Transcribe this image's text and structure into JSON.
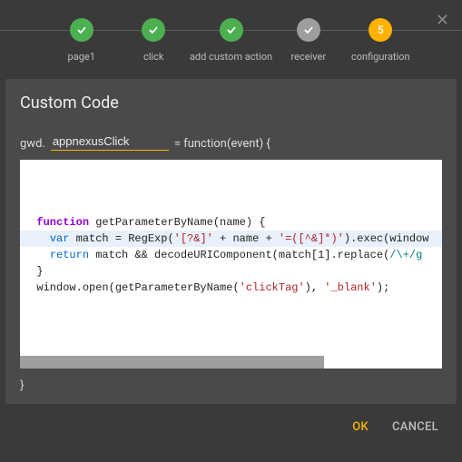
{
  "stepper": {
    "steps": [
      {
        "label": "page1",
        "state": "done"
      },
      {
        "label": "click",
        "state": "done"
      },
      {
        "label": "add custom action",
        "state": "done"
      },
      {
        "label": "receiver",
        "state": "grey"
      },
      {
        "label": "configuration",
        "state": "active",
        "number": "5"
      }
    ]
  },
  "colors": {
    "done": "#4caf50",
    "grey": "#9e9e9e",
    "active": "#ffb300"
  },
  "panel": {
    "title": "Custom Code",
    "prefix": "gwd.",
    "function_name": "appnexusClick",
    "suffix": "= function(event) {",
    "closing": "}"
  },
  "code": {
    "line1_kw": "function",
    "line1_name": " getParameterByName(name) {",
    "line2_kw": "var",
    "line2_a": " match = RegExp(",
    "line2_s1": "'[?&]'",
    "line2_b": " + name + ",
    "line2_s2": "'=([^&]*)'",
    "line2_c": ").exec(window",
    "line3_kw": "return",
    "line3_a": " match && decodeURIComponent(match[1].replace(",
    "line3_re": "/\\+/g",
    "line4": "}",
    "line5_a": "window.open(getParameterByName(",
    "line5_s1": "'clickTag'",
    "line5_b": "), ",
    "line5_s2": "'_blank'",
    "line5_c": ");"
  },
  "footer": {
    "ok": "OK",
    "cancel": "CANCEL"
  }
}
